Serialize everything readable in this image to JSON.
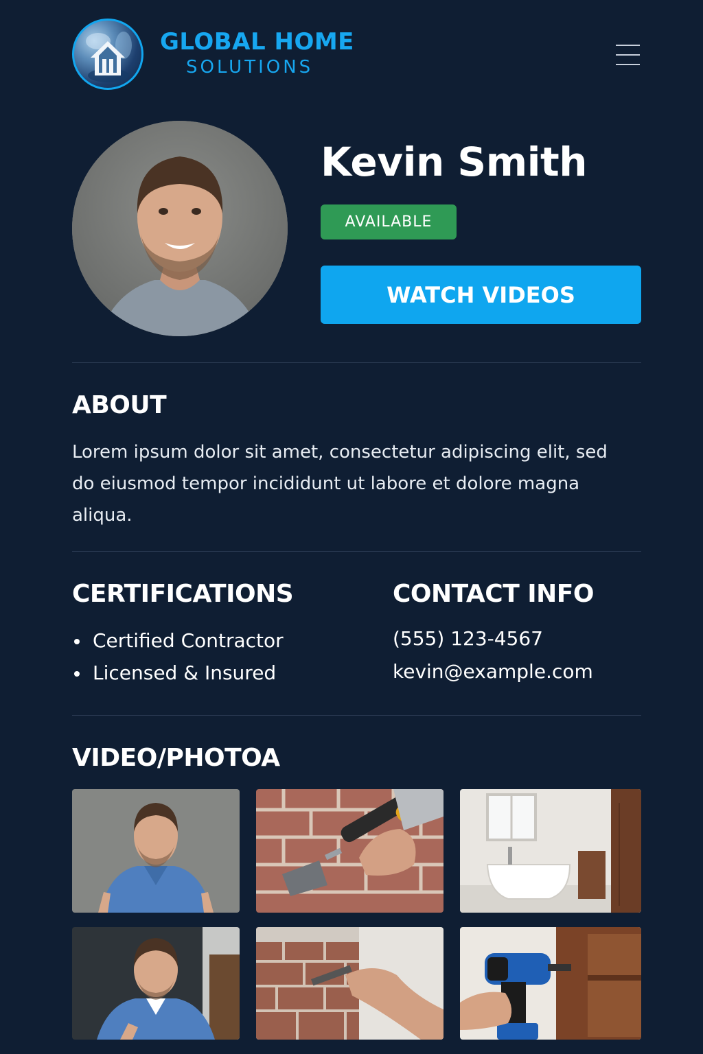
{
  "brand": {
    "line1": "GLOBAL HOME",
    "line2": "SOLUTIONS",
    "logo_icon": "house-globe-icon",
    "accent_color": "#17a7f0"
  },
  "header": {
    "menu_icon": "hamburger-menu-icon"
  },
  "profile": {
    "name": "Kevin Smith",
    "status": "AVAILABLE",
    "status_color": "#2f9a55",
    "watch_label": "WATCH VIDEOS",
    "watch_color": "#0fa6ef"
  },
  "about": {
    "heading": "ABOUT",
    "text": "Lorem ipsum dolor sit amet, consectetur adipiscing elit, sed do eiusmod tempor incididunt ut labore et dolore magna aliqua."
  },
  "certifications": {
    "heading": "CERTIFICATIONS",
    "items": [
      "Certified Contractor",
      "Licensed & Insured"
    ]
  },
  "contact": {
    "heading": "CONTACT INFO",
    "phone": "(555) 123-4567",
    "email": "kevin@example.com"
  },
  "gallery": {
    "heading": "VIDEO/PHOTOA",
    "items": [
      {
        "subject": "portrait-photo"
      },
      {
        "subject": "brick-trowel-photo"
      },
      {
        "subject": "bathroom-photo"
      },
      {
        "subject": "portrait-photo"
      },
      {
        "subject": "brick-repair-photo"
      },
      {
        "subject": "drill-cabinet-photo"
      }
    ]
  },
  "theme": {
    "background": "#0f1e33",
    "divider": "#2a3a52"
  }
}
